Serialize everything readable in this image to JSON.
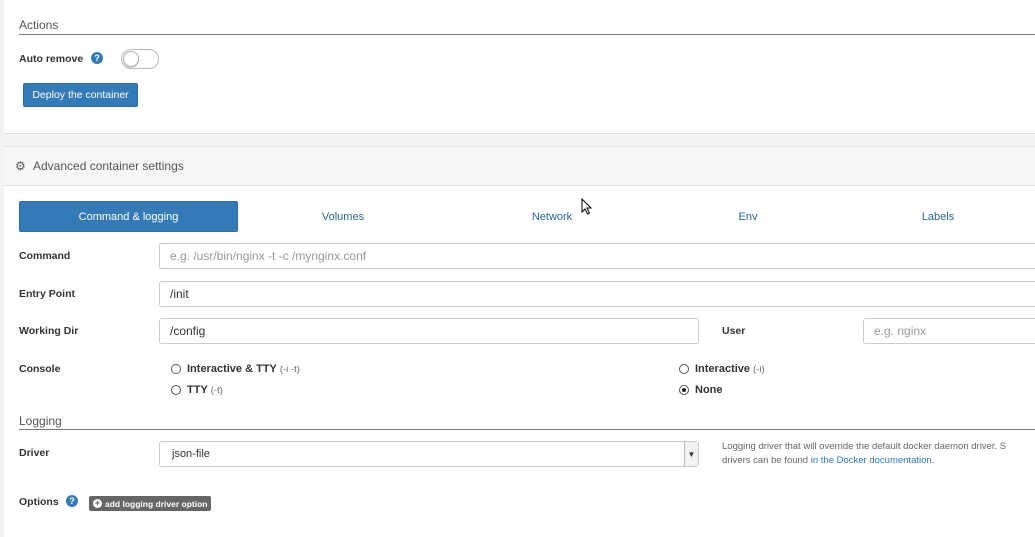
{
  "actions": {
    "section_title": "Actions",
    "auto_remove_label": "Auto remove",
    "auto_remove_enabled": false,
    "deploy_button": "Deploy the container"
  },
  "advanced": {
    "title": "Advanced container settings",
    "icon": "gear-icon"
  },
  "tabs": [
    {
      "label": "Command & logging",
      "active": true
    },
    {
      "label": "Volumes",
      "active": false
    },
    {
      "label": "Network",
      "active": false
    },
    {
      "label": "Env",
      "active": false
    },
    {
      "label": "Labels",
      "active": false
    }
  ],
  "form": {
    "command": {
      "label": "Command",
      "value": "",
      "placeholder": "e.g. /usr/bin/nginx -t -c /mynginx.conf"
    },
    "entry_point": {
      "label": "Entry Point",
      "value": "/init"
    },
    "working_dir": {
      "label": "Working Dir",
      "value": "/config"
    },
    "user": {
      "label": "User",
      "value": "",
      "placeholder": "e.g. nginx"
    },
    "console": {
      "label": "Console",
      "options": [
        {
          "label": "Interactive & TTY",
          "hint": "(-i -t)",
          "selected": false
        },
        {
          "label": "Interactive",
          "hint": "(-i)",
          "selected": false
        },
        {
          "label": "TTY",
          "hint": "(-t)",
          "selected": false
        },
        {
          "label": "None",
          "hint": "",
          "selected": true
        }
      ]
    }
  },
  "logging": {
    "section_title": "Logging",
    "driver_label": "Driver",
    "driver_value": "json-file",
    "driver_desc_line1": "Logging driver that will override the default docker daemon driver. S",
    "driver_desc_line2_prefix": "drivers can be found ",
    "driver_desc_link": "in the Docker documentation",
    "driver_desc_line2_suffix": ".",
    "options_label": "Options",
    "add_option_button": "add logging driver option"
  },
  "colors": {
    "primary": "#337ab7",
    "link": "#2a6496"
  }
}
